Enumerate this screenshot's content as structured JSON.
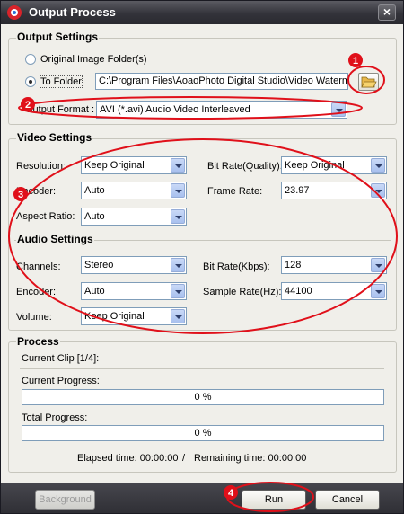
{
  "window": {
    "title": "Output Process",
    "close_glyph": "×"
  },
  "output_settings": {
    "title": "Output Settings",
    "original_folder_label": "Original Image Folder(s)",
    "to_folder_label": "To Folder",
    "folder_path": "C:\\Program Files\\AoaoPhoto Digital Studio\\Video Waterma",
    "output_format_label": "Output Format :",
    "output_format_value": "AVI  (*.avi) Audio Video Interleaved"
  },
  "video_settings": {
    "title": "Video Settings",
    "resolution_label": "Resolution:",
    "resolution_value": "Keep Original",
    "bitrate_label": "Bit Rate(Quality):",
    "bitrate_value": "Keep Original",
    "encoder_label": "Encoder:",
    "encoder_value": "Auto",
    "framerate_label": "Frame Rate:",
    "framerate_value": "23.97",
    "aspect_label": "Aspect Ratio:",
    "aspect_value": "Auto"
  },
  "audio_settings": {
    "title": "Audio Settings",
    "channels_label": "Channels:",
    "channels_value": "Stereo",
    "bitrate_label": "Bit Rate(Kbps):",
    "bitrate_value": "128",
    "encoder_label": "Encoder:",
    "encoder_value": "Auto",
    "samplerate_label": "Sample Rate(Hz):",
    "samplerate_value": "44100",
    "volume_label": "Volume:",
    "volume_value": "Keep Original"
  },
  "process": {
    "title": "Process",
    "current_clip": "Current Clip [1/4]:",
    "current_progress_label": "Current Progress:",
    "current_progress_text": "0 %",
    "current_progress_fraction": 0,
    "total_progress_label": "Total Progress:",
    "total_progress_text": "0 %",
    "total_progress_fraction": 0,
    "elapsed": "Elapsed time: 00:00:00",
    "divider": "/",
    "remaining": "Remaining time: 00:00:00"
  },
  "buttons": {
    "background": "Background",
    "run": "Run",
    "cancel": "Cancel"
  },
  "annotations": {
    "n1": "1",
    "n2": "2",
    "n3": "3",
    "n4": "4",
    "color": "#e0101a"
  }
}
